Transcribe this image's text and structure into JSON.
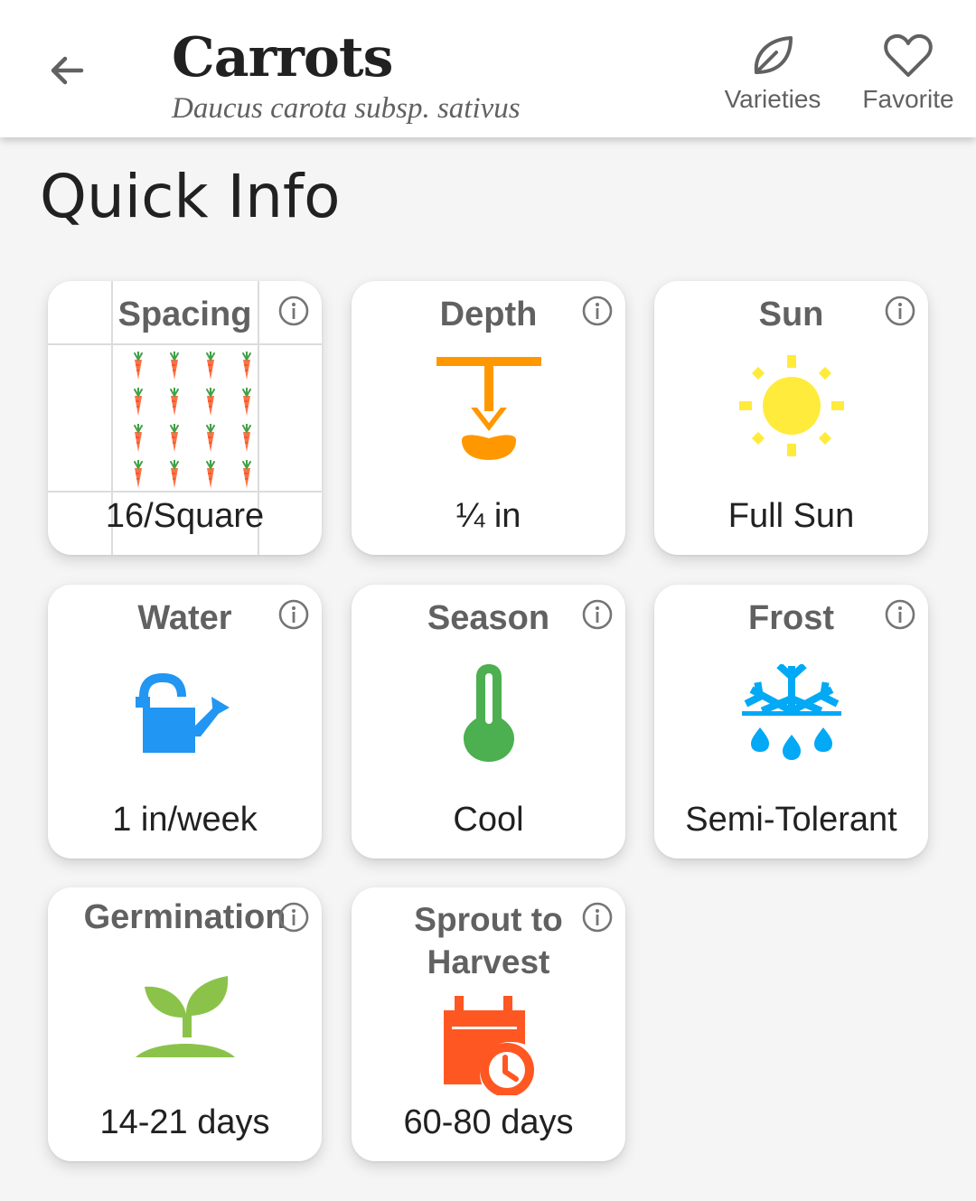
{
  "header": {
    "title": "Carrots",
    "subtitle": "Daucus carota subsp. sativus",
    "back_icon": "arrow-left-icon",
    "actions": [
      {
        "label": "Varieties",
        "icon": "leaf-outline-icon"
      },
      {
        "label": "Favorite",
        "icon": "heart-outline-icon"
      }
    ]
  },
  "section": {
    "title": "Quick Info"
  },
  "cards": [
    {
      "label": "Spacing",
      "value": "16/Square",
      "icon": "carrot-grid-icon",
      "plants_per_square": 16,
      "color": "#ff7043"
    },
    {
      "label": "Depth",
      "value": "¼ in",
      "icon": "planting-depth-icon",
      "color": "#ff9800"
    },
    {
      "label": "Sun",
      "value": "Full Sun",
      "icon": "sun-icon",
      "color": "#ffeb3b"
    },
    {
      "label": "Water",
      "value": "1 in/week",
      "icon": "watering-can-icon",
      "color": "#2196f3"
    },
    {
      "label": "Season",
      "value": "Cool",
      "icon": "thermometer-icon",
      "color": "#4caf50"
    },
    {
      "label": "Frost",
      "value": "Semi-Tolerant",
      "icon": "frost-snowflake-icon",
      "color": "#03a9f4"
    },
    {
      "label": "Germination",
      "value": "14-21 days",
      "icon": "sprout-icon",
      "color": "#8bc34a"
    },
    {
      "label": "Sprout to Harvest",
      "label_lines": [
        "Sprout to",
        "Harvest"
      ],
      "value": "60-80 days",
      "icon": "calendar-clock-icon",
      "color": "#ff5722"
    }
  ],
  "info_icon": "info-circle-icon"
}
